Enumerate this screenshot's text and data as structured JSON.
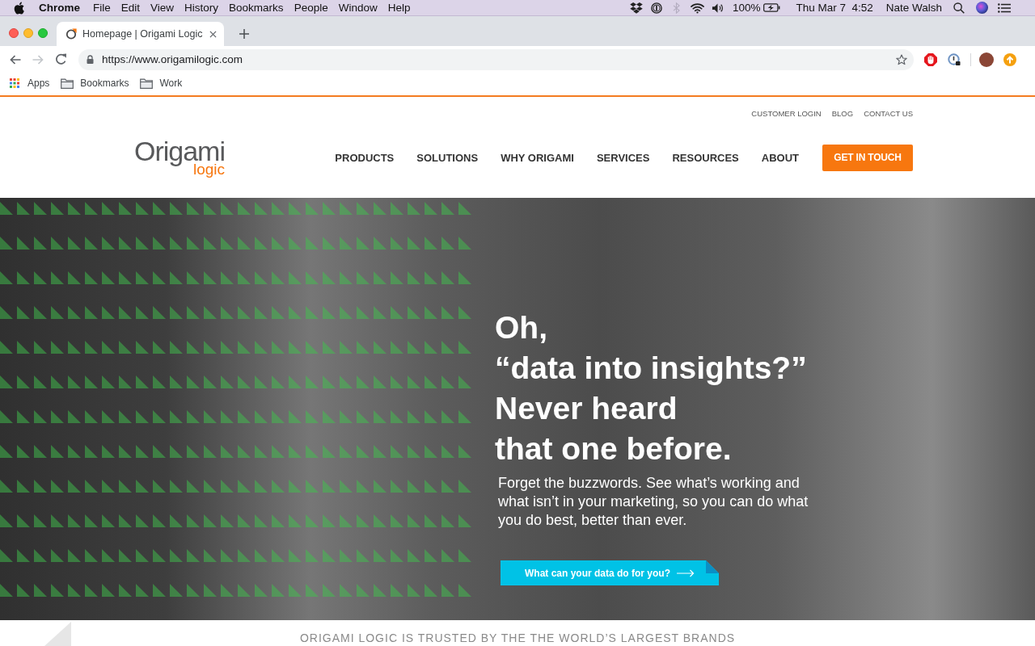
{
  "menu_bar": {
    "app_name": "Chrome",
    "menus": [
      "File",
      "Edit",
      "View",
      "History",
      "Bookmarks",
      "People",
      "Window",
      "Help"
    ],
    "bluetooth_on": false,
    "battery": "100%",
    "clock": "Thu Mar 7  4:52",
    "user": "Nate Walsh"
  },
  "browser": {
    "tabs": [
      {
        "title": "Homepage | Origami Logic",
        "selected": true
      }
    ],
    "forward_disabled": true,
    "url": "https://www.origamilogic.com",
    "bookmarks": [
      {
        "kind": "apps",
        "label": "Apps"
      },
      {
        "kind": "folder",
        "label": "Bookmarks"
      },
      {
        "kind": "folder",
        "label": "Work"
      }
    ]
  },
  "site": {
    "utility_links": [
      "CUSTOMER LOGIN",
      "BLOG",
      "CONTACT US"
    ],
    "logo": {
      "wordmark": "Origami",
      "tagline": "logic"
    },
    "nav": [
      "PRODUCTS",
      "SOLUTIONS",
      "WHY ORIGAMI",
      "SERVICES",
      "RESOURCES",
      "ABOUT"
    ],
    "header_button": "GET IN TOUCH",
    "hero": {
      "headline_lines": [
        "Oh,",
        "“data into insights?”",
        "Never heard",
        "that one before."
      ],
      "body": "Forget the buzzwords. See what’s working and what isn’t in your marketing, so you can do what you do best, better than ever.",
      "button": "What can your data do for you?"
    },
    "trusted_heading": "ORIGAMI LOGIC IS TRUSTED BY THE THE WORLD’S LARGEST BRANDS"
  }
}
